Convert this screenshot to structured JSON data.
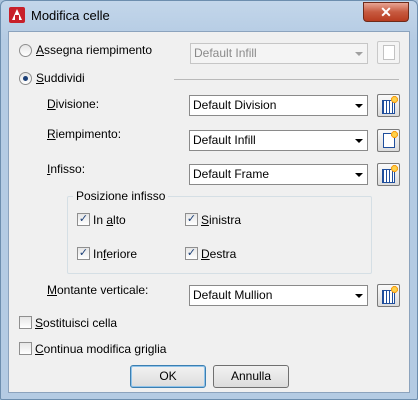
{
  "window": {
    "title": "Modifica celle",
    "close_label": "✕"
  },
  "options": {
    "assign_fill": {
      "label_underlined": "A",
      "label_rest": "ssegna riempimento",
      "selected": false,
      "select_value": "Default Infill"
    },
    "subdivide": {
      "label_underlined": "S",
      "label_rest": "uddividi",
      "selected": true
    }
  },
  "subdivide_fields": {
    "division": {
      "label_underlined": "D",
      "label_rest": "ivisione:",
      "value": "Default Division"
    },
    "infill": {
      "label_underlined": "R",
      "label_rest": "iempimento:",
      "value": "Default Infill"
    },
    "frame": {
      "label_underlined": "I",
      "label_rest": "nfisso:",
      "value": "Default Frame"
    }
  },
  "frame_position": {
    "title": "Posizione infisso",
    "top": {
      "pre": "In ",
      "underlined": "a",
      "post": "lto",
      "checked": true
    },
    "left": {
      "pre": "",
      "underlined": "S",
      "post": "inistra",
      "checked": true
    },
    "bottom": {
      "pre": "In",
      "underlined": "f",
      "post": "eriore",
      "checked": true
    },
    "right": {
      "pre": "",
      "underlined": "D",
      "post": "estra",
      "checked": true
    },
    "check_glyph": "✓"
  },
  "mullion": {
    "label_underlined": "M",
    "label_rest": "ontante verticale:",
    "value": "Default Mullion"
  },
  "checkboxes": {
    "replace_cell": {
      "underlined": "S",
      "rest": "ostituisci cella",
      "checked": false
    },
    "continue_edit": {
      "underlined": "C",
      "rest": "ontinua modifica griglia",
      "checked": false
    }
  },
  "buttons": {
    "ok": "OK",
    "cancel": "Annulla"
  },
  "icons": {
    "app": "autocad-icon",
    "style_browse": "style-browse-icon",
    "infill_browse": "infill-browse-icon"
  },
  "colors": {
    "accent": "#1f4e9c",
    "close": "#c75a40"
  }
}
